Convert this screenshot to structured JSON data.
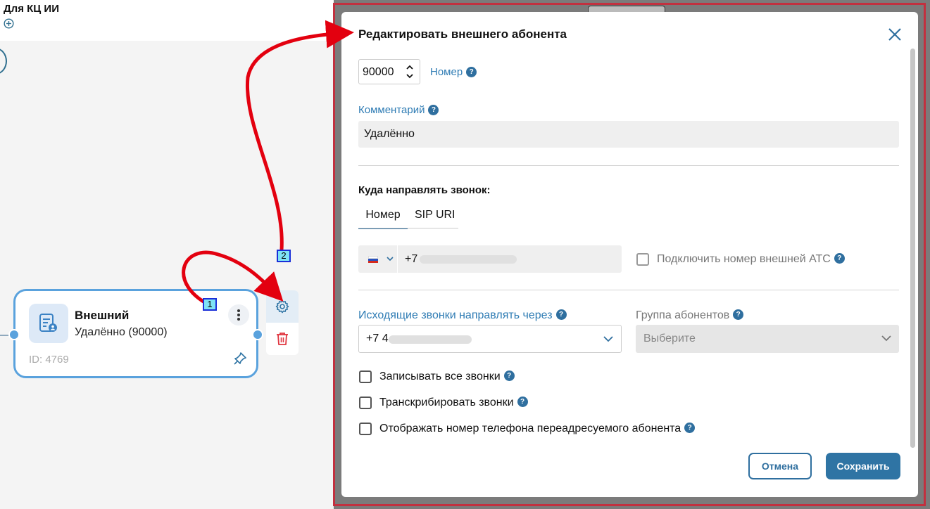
{
  "canvas": {
    "title": "Для КЦ ИИ",
    "node": {
      "title": "Внешний",
      "subtitle": "Удалённо (90000)",
      "id_label": "ID: 4769"
    },
    "callouts": [
      "1",
      "2"
    ]
  },
  "modal": {
    "title": "Редактировать внешнего абонента",
    "number_value": "90000",
    "number_label": "Номер",
    "comment_label": "Комментарий",
    "comment_value": "Удалённо",
    "route_label": "Куда направлять звонок:",
    "tabs": [
      {
        "label": "Номер",
        "active": true
      },
      {
        "label": "SIP URI",
        "active": false
      }
    ],
    "phone_prefix": "+7",
    "external_pbx_label": "Подключить номер внешней АТС",
    "outgoing_label": "Исходящие звонки направлять через",
    "outgoing_value": "+7 4",
    "group_label": "Группа абонентов",
    "group_placeholder": "Выберите",
    "checkboxes": [
      {
        "label": "Записывать все звонки",
        "checked": false
      },
      {
        "label": "Транскрибировать звонки",
        "checked": false
      },
      {
        "label": "Отображать номер телефона переадресуемого абонента",
        "checked": false
      }
    ],
    "cancel_label": "Отмена",
    "save_label": "Сохранить",
    "help_glyph": "?"
  },
  "colors": {
    "accent": "#2f74a4",
    "annotation_arrow": "#e3000f",
    "highlight_frame": "#c2303f",
    "delete": "#e0353f"
  }
}
